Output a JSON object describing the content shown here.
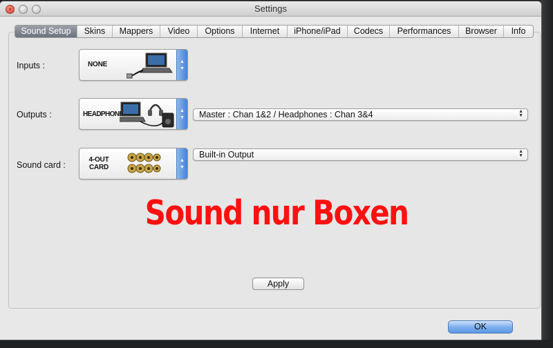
{
  "window": {
    "title": "Settings"
  },
  "tabs": [
    {
      "label": "Sound Setup",
      "active": true
    },
    {
      "label": "Skins",
      "active": false
    },
    {
      "label": "Mappers",
      "active": false
    },
    {
      "label": "Video",
      "active": false
    },
    {
      "label": "Options",
      "active": false
    },
    {
      "label": "Internet",
      "active": false
    },
    {
      "label": "iPhone/iPad",
      "active": false
    },
    {
      "label": "Codecs",
      "active": false
    },
    {
      "label": "Performances",
      "active": false
    },
    {
      "label": "Browser",
      "active": false
    },
    {
      "label": "Info",
      "active": false
    }
  ],
  "sound_setup": {
    "inputs": {
      "label": "Inputs :",
      "selected": "NONE",
      "icon": "laptop-with-cable-icon"
    },
    "outputs": {
      "label": "Outputs :",
      "selected": "HEADPHONES",
      "icon": "laptop-headphones-speaker-icon",
      "routing": "Master : Chan 1&2 / Headphones : Chan 3&4"
    },
    "sound_card": {
      "label": "Sound card :",
      "selected_line1": "4-OUT",
      "selected_line2": "CARD",
      "icon": "rca-jacks-icon",
      "device": "Built-in Output"
    }
  },
  "overlay_text": "Sound nur Boxen",
  "buttons": {
    "apply": "Apply",
    "ok": "OK"
  },
  "colors": {
    "overlay": "#ff1010",
    "accent": "#3f82d9",
    "active_tab": "#6c737c"
  }
}
